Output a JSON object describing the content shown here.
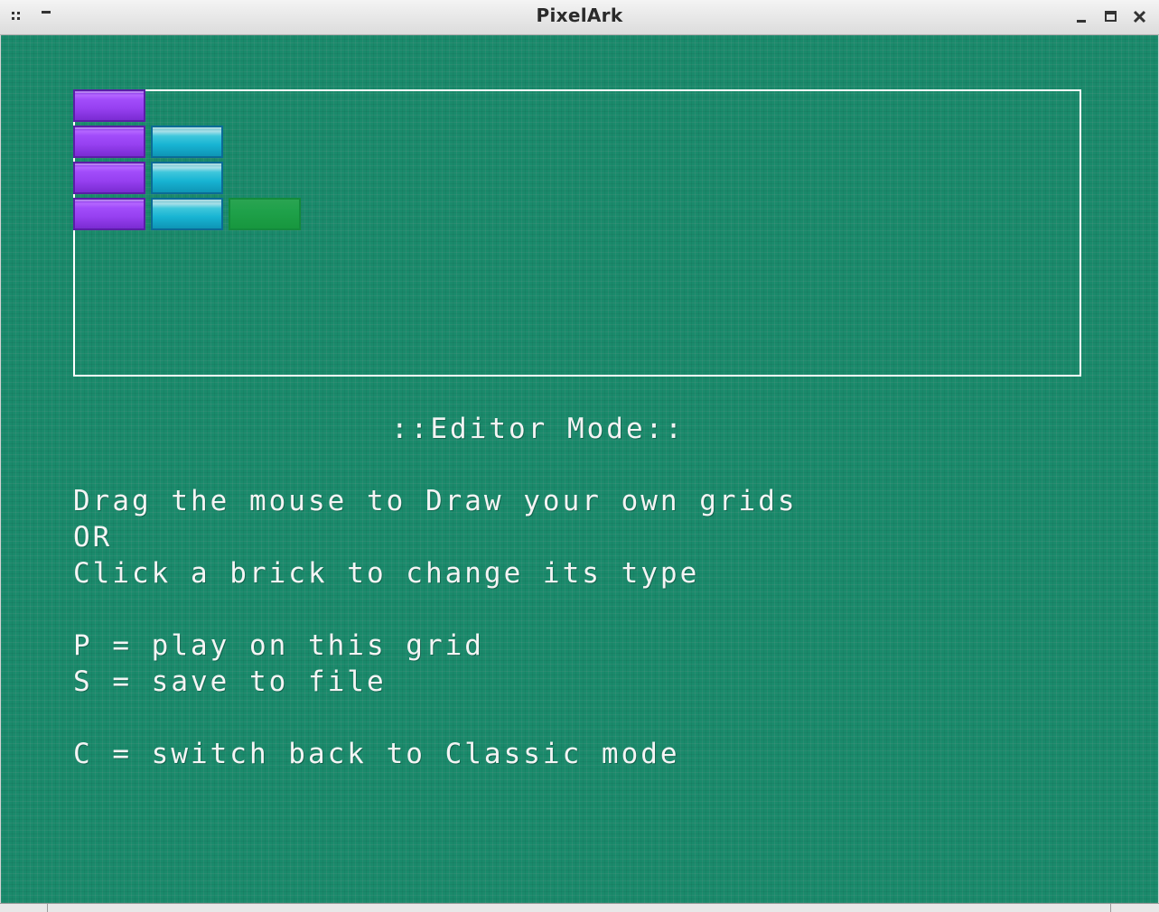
{
  "window": {
    "title": "PixelArk"
  },
  "titlebar_icons": {
    "menu": "window-menu-icon",
    "shade": "shade-icon",
    "minimize": "minimize-icon",
    "maximize": "maximize-icon",
    "close": "close-icon"
  },
  "colors": {
    "background": "#1a8a6b",
    "text": "#f4f4f4",
    "grid_border": "#ffffff",
    "brick_purple": "#9640f0",
    "brick_cyan": "#18b4d3",
    "brick_green": "#17973e"
  },
  "editor": {
    "heading": "::Editor Mode::",
    "lines": [
      "Drag the mouse to Draw your own grids",
      "OR",
      "Click a brick to change its type",
      "P = play on this grid",
      "S = save to file",
      "C = switch back to Classic mode"
    ]
  },
  "bricks": [
    {
      "row": 0,
      "col": 0,
      "type": "purple"
    },
    {
      "row": 1,
      "col": 0,
      "type": "purple"
    },
    {
      "row": 1,
      "col": 1,
      "type": "cyan"
    },
    {
      "row": 2,
      "col": 0,
      "type": "purple"
    },
    {
      "row": 2,
      "col": 1,
      "type": "cyan"
    },
    {
      "row": 3,
      "col": 0,
      "type": "purple"
    },
    {
      "row": 3,
      "col": 1,
      "type": "cyan"
    },
    {
      "row": 3,
      "col": 2,
      "type": "green"
    }
  ]
}
